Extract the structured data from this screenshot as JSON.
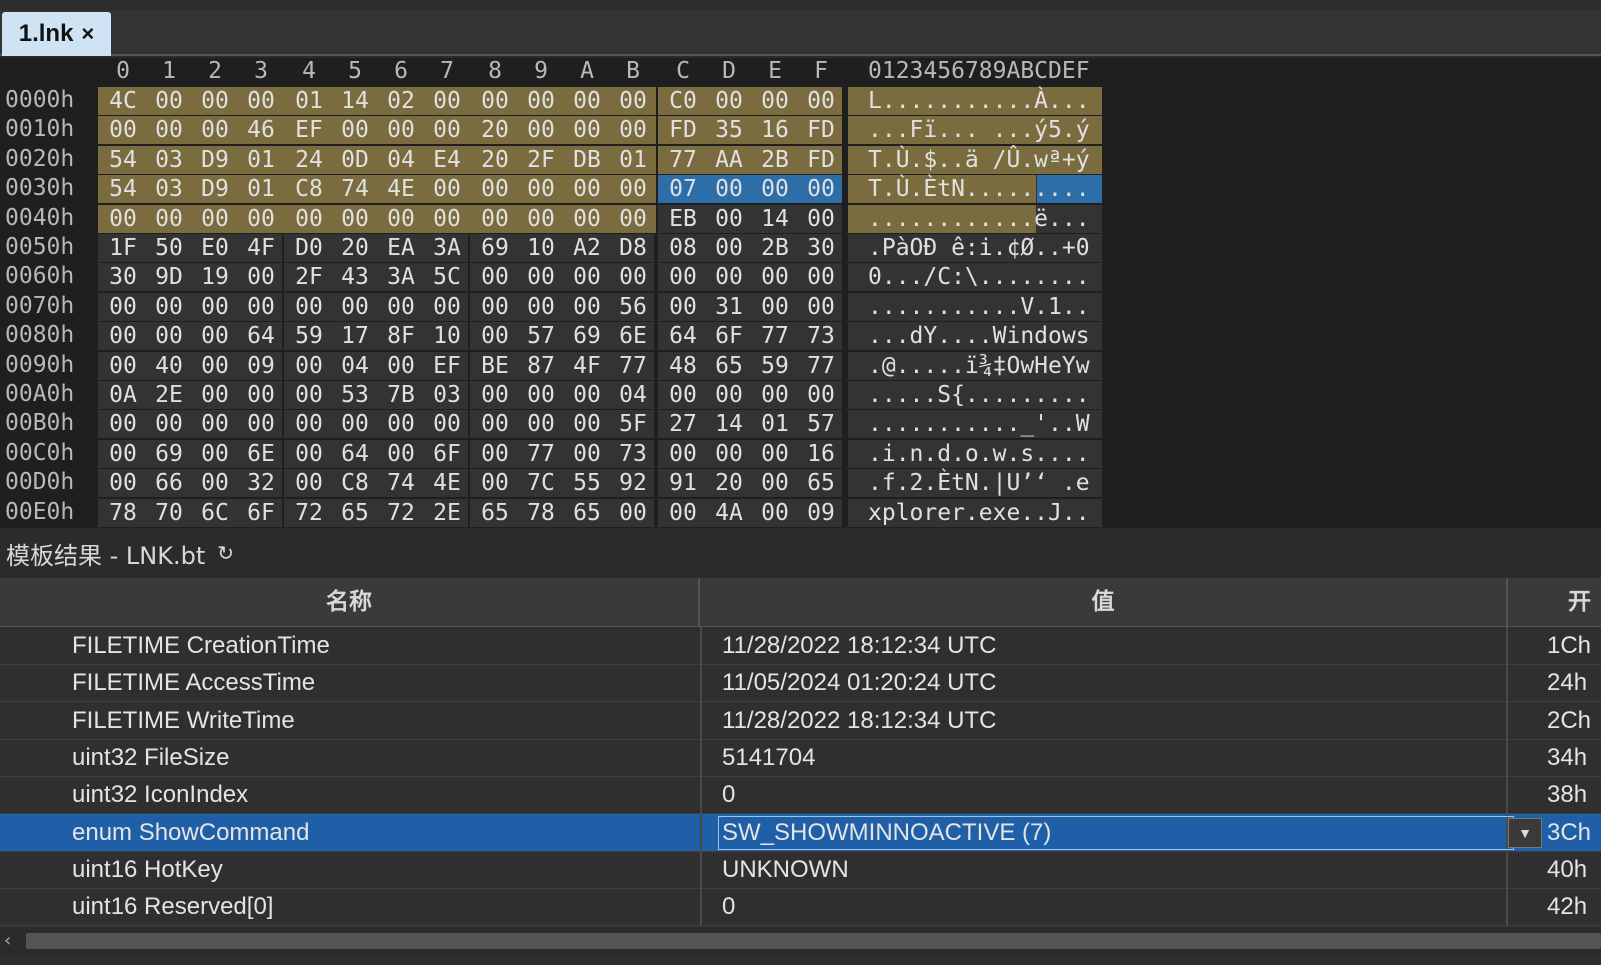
{
  "tab": {
    "label": "1.lnk",
    "close": "×"
  },
  "hex": {
    "columns": [
      "0",
      "1",
      "2",
      "3",
      "4",
      "5",
      "6",
      "7",
      "8",
      "9",
      "A",
      "B",
      "C",
      "D",
      "E",
      "F"
    ],
    "ascii_header": "0123456789ABCDEF",
    "rows": [
      {
        "offset": "0000h",
        "bytes": [
          "4C",
          "00",
          "00",
          "00",
          "01",
          "14",
          "02",
          "00",
          "00",
          "00",
          "00",
          "00",
          "C0",
          "00",
          "00",
          "00"
        ],
        "ascii": "L...........À..."
      },
      {
        "offset": "0010h",
        "bytes": [
          "00",
          "00",
          "00",
          "46",
          "EF",
          "00",
          "00",
          "00",
          "20",
          "00",
          "00",
          "00",
          "FD",
          "35",
          "16",
          "FD"
        ],
        "ascii": "...Fï... ...ý5.ý"
      },
      {
        "offset": "0020h",
        "bytes": [
          "54",
          "03",
          "D9",
          "01",
          "24",
          "0D",
          "04",
          "E4",
          "20",
          "2F",
          "DB",
          "01",
          "77",
          "AA",
          "2B",
          "FD"
        ],
        "ascii": "T.Ù.$..ä /Û.wª+ý"
      },
      {
        "offset": "0030h",
        "bytes": [
          "54",
          "03",
          "D9",
          "01",
          "C8",
          "74",
          "4E",
          "00",
          "00",
          "00",
          "00",
          "00",
          "07",
          "00",
          "00",
          "00"
        ],
        "ascii": "T.Ù.ÈtN........."
      },
      {
        "offset": "0040h",
        "bytes": [
          "00",
          "00",
          "00",
          "00",
          "00",
          "00",
          "00",
          "00",
          "00",
          "00",
          "00",
          "00",
          "EB",
          "00",
          "14",
          "00"
        ],
        "ascii": "............ë..."
      },
      {
        "offset": "0050h",
        "bytes": [
          "1F",
          "50",
          "E0",
          "4F",
          "D0",
          "20",
          "EA",
          "3A",
          "69",
          "10",
          "A2",
          "D8",
          "08",
          "00",
          "2B",
          "30"
        ],
        "ascii": ".PàOÐ ê:i.¢Ø..+0"
      },
      {
        "offset": "0060h",
        "bytes": [
          "30",
          "9D",
          "19",
          "00",
          "2F",
          "43",
          "3A",
          "5C",
          "00",
          "00",
          "00",
          "00",
          "00",
          "00",
          "00",
          "00"
        ],
        "ascii": "0.../C:\\........"
      },
      {
        "offset": "0070h",
        "bytes": [
          "00",
          "00",
          "00",
          "00",
          "00",
          "00",
          "00",
          "00",
          "00",
          "00",
          "00",
          "56",
          "00",
          "31",
          "00",
          "00"
        ],
        "ascii": "...........V.1.."
      },
      {
        "offset": "0080h",
        "bytes": [
          "00",
          "00",
          "00",
          "64",
          "59",
          "17",
          "8F",
          "10",
          "00",
          "57",
          "69",
          "6E",
          "64",
          "6F",
          "77",
          "73"
        ],
        "ascii": "...dY....Windows"
      },
      {
        "offset": "0090h",
        "bytes": [
          "00",
          "40",
          "00",
          "09",
          "00",
          "04",
          "00",
          "EF",
          "BE",
          "87",
          "4F",
          "77",
          "48",
          "65",
          "59",
          "77"
        ],
        "ascii": ".@.....ï¾‡OwHeYw"
      },
      {
        "offset": "00A0h",
        "bytes": [
          "0A",
          "2E",
          "00",
          "00",
          "00",
          "53",
          "7B",
          "03",
          "00",
          "00",
          "00",
          "04",
          "00",
          "00",
          "00",
          "00"
        ],
        "ascii": ".....S{........."
      },
      {
        "offset": "00B0h",
        "bytes": [
          "00",
          "00",
          "00",
          "00",
          "00",
          "00",
          "00",
          "00",
          "00",
          "00",
          "00",
          "5F",
          "27",
          "14",
          "01",
          "57"
        ],
        "ascii": "..........._'..W"
      },
      {
        "offset": "00C0h",
        "bytes": [
          "00",
          "69",
          "00",
          "6E",
          "00",
          "64",
          "00",
          "6F",
          "00",
          "77",
          "00",
          "73",
          "00",
          "00",
          "00",
          "16"
        ],
        "ascii": ".i.n.d.o.w.s...."
      },
      {
        "offset": "00D0h",
        "bytes": [
          "00",
          "66",
          "00",
          "32",
          "00",
          "C8",
          "74",
          "4E",
          "00",
          "7C",
          "55",
          "92",
          "91",
          "20",
          "00",
          "65"
        ],
        "ascii": ".f.2.ÈtN.|U’‘ .e"
      },
      {
        "offset": "00E0h",
        "bytes": [
          "78",
          "70",
          "6C",
          "6F",
          "72",
          "65",
          "72",
          "2E",
          "65",
          "78",
          "65",
          "00",
          "00",
          "4A",
          "00",
          "09"
        ],
        "ascii": "xplorer.exe..J.."
      }
    ]
  },
  "template": {
    "title": "模板结果 - LNK.bt",
    "refresh_icon": "↻",
    "columns": {
      "name": "名称",
      "value": "值",
      "start": "开"
    },
    "rows": [
      {
        "name": "FILETIME CreationTime",
        "value": "11/28/2022 18:12:34 UTC",
        "start": "1Ch"
      },
      {
        "name": "FILETIME AccessTime",
        "value": "11/05/2024 01:20:24 UTC",
        "start": "24h"
      },
      {
        "name": "FILETIME WriteTime",
        "value": "11/28/2022 18:12:34 UTC",
        "start": "2Ch"
      },
      {
        "name": "uint32 FileSize",
        "value": "5141704",
        "start": "34h"
      },
      {
        "name": "uint32 IconIndex",
        "value": "0",
        "start": "38h"
      },
      {
        "name": "enum ShowCommand",
        "value": "SW_SHOWMINNOACTIVE (7)",
        "start": "3Ch",
        "selected": true
      },
      {
        "name": "uint16 HotKey",
        "value": "UNKNOWN",
        "start": "40h"
      },
      {
        "name": "uint16 Reserved[0]",
        "value": "0",
        "start": "42h"
      }
    ]
  },
  "colors": {
    "highlight": "#7a6c3f",
    "selection": "#2d6ea8",
    "row_selected": "#1f5fa8"
  }
}
